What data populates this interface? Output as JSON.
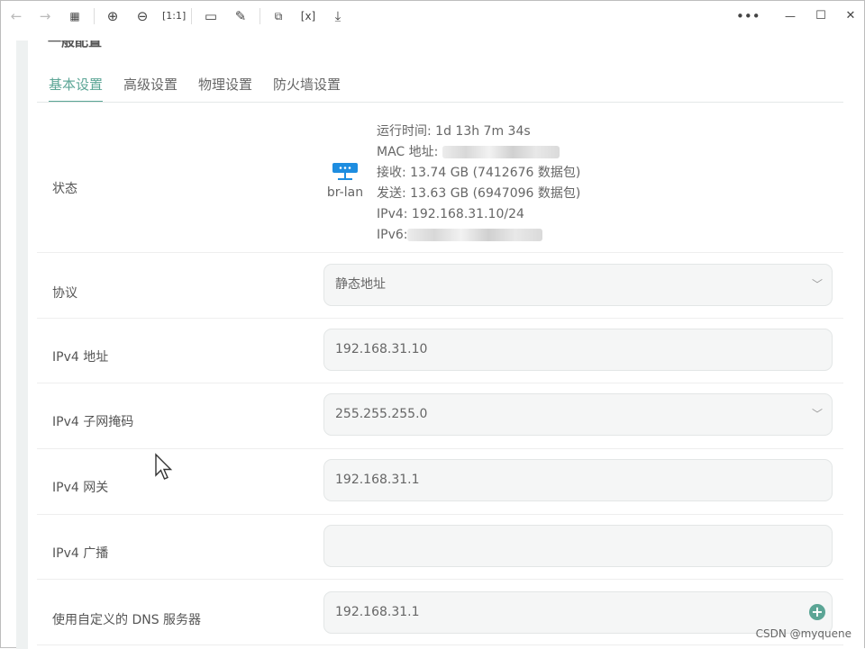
{
  "toolbar": {
    "buttons": [
      "back",
      "forward",
      "apps",
      "zoom-in",
      "zoom-out",
      "actual-size",
      "rotate",
      "edit",
      "translate",
      "ocr",
      "download"
    ],
    "more": "•••",
    "minimize": "—",
    "maximize": "☐",
    "close": "✕"
  },
  "panel": {
    "title": "一般配置",
    "tabs": [
      {
        "label": "基本设置",
        "active": true
      },
      {
        "label": "高级设置"
      },
      {
        "label": "物理设置"
      },
      {
        "label": "防火墙设置"
      }
    ]
  },
  "status": {
    "label": "状态",
    "interface": "br-lan",
    "uptime": "运行时间: 1d 13h 7m 34s",
    "mac_label": "MAC 地址:",
    "rx": "接收: 13.74 GB (7412676 数据包)",
    "tx": "发送: 13.63 GB (6947096 数据包)",
    "ipv4": "IPv4: 192.168.31.10/24",
    "ipv6_label": "IPv6:"
  },
  "fields": [
    {
      "label": "协议",
      "value": "静态地址",
      "type": "select"
    },
    {
      "label": "IPv4 地址",
      "value": "192.168.31.10",
      "type": "input"
    },
    {
      "label": "IPv4 子网掩码",
      "value": "255.255.255.0",
      "type": "select"
    },
    {
      "label": "IPv4 网关",
      "value": "192.168.31.1",
      "type": "input"
    },
    {
      "label": "IPv4 广播",
      "value": "",
      "type": "input"
    },
    {
      "label": "使用自定义的 DNS 服务器",
      "value": "192.168.31.1",
      "type": "input-add"
    }
  ],
  "watermark": "CSDN @myquene",
  "accent": "#5ba595"
}
